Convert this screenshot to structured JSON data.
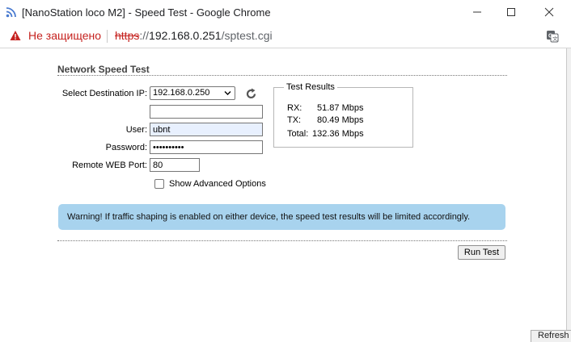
{
  "window": {
    "title": "[NanoStation loco M2] - Speed Test - Google Chrome"
  },
  "address_bar": {
    "security_label": "Не защищено",
    "url_protocol": "https",
    "url_separator": "://",
    "url_host": "192.168.0.251",
    "url_path": "/sptest.cgi"
  },
  "page": {
    "section_title": "Network Speed Test",
    "form": {
      "destination_label": "Select Destination IP:",
      "destination_value": "192.168.0.250",
      "custom_ip_value": "",
      "user_label": "User:",
      "user_value": "ubnt",
      "password_label": "Password:",
      "password_value": "••••••••••",
      "port_label": "Remote WEB Port:",
      "port_value": "80",
      "advanced_label": "Show Advanced Options",
      "advanced_checked": false
    },
    "results": {
      "legend": "Test Results",
      "rx_label": "RX:",
      "rx_value": "51.87 Mbps",
      "tx_label": "TX:",
      "tx_value": "80.49 Mbps",
      "total_label": "Total:",
      "total_value": "132.36 Mbps"
    },
    "warning_text": "Warning! If traffic shaping is enabled on either device, the speed test results will be limited accordingly.",
    "run_button": "Run Test"
  },
  "background": {
    "partial_button": "Refresh"
  },
  "colors": {
    "not_secure": "#c5221f",
    "warning_bg": "#a8d3ee",
    "autofill_bg": "#e8f0fe"
  },
  "icons": {
    "favicon": "wireless-signal-icon",
    "security": "warning-triangle-icon",
    "translate": "translate-icon",
    "refresh": "refresh-icon"
  }
}
